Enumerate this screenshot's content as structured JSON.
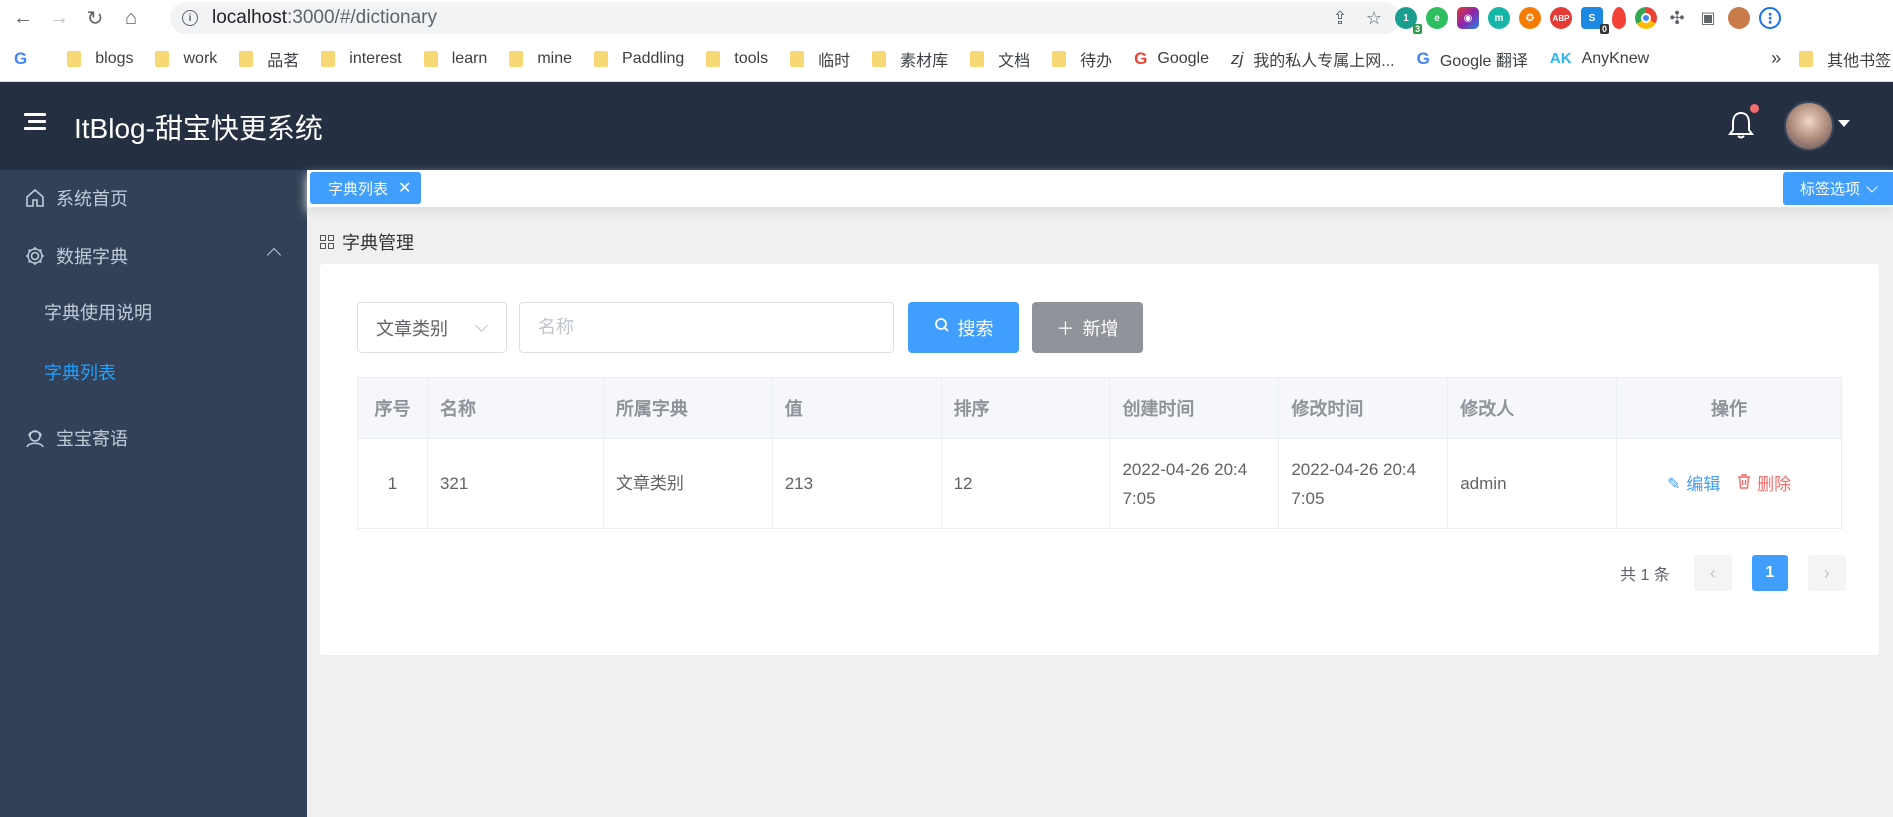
{
  "browser": {
    "url_host": "localhost",
    "url_rest": ":3000/#/dictionary",
    "bookmarks": [
      {
        "label": "blogs",
        "type": "folder"
      },
      {
        "label": "work",
        "type": "folder"
      },
      {
        "label": "品茗",
        "type": "folder"
      },
      {
        "label": "interest",
        "type": "folder"
      },
      {
        "label": "learn",
        "type": "folder"
      },
      {
        "label": "mine",
        "type": "folder"
      },
      {
        "label": "Paddling",
        "type": "folder"
      },
      {
        "label": "tools",
        "type": "folder"
      },
      {
        "label": "临时",
        "type": "folder"
      },
      {
        "label": "素材库",
        "type": "folder"
      },
      {
        "label": "文档",
        "type": "folder"
      },
      {
        "label": "待办",
        "type": "folder"
      },
      {
        "label": "Google",
        "type": "google"
      },
      {
        "label": "我的私人专属上网...",
        "type": "site"
      },
      {
        "label": "Google 翻译",
        "type": "translate"
      },
      {
        "label": "AnyKnew",
        "type": "ak"
      }
    ],
    "bookmark_overflow": "»",
    "other_bookmarks": "其他书签",
    "extension_badges": {
      "first": "3",
      "second": "0"
    }
  },
  "header": {
    "title": "ItBlog-甜宝快更系统"
  },
  "sidebar": {
    "home": "系统首页",
    "dictionary_group": "数据字典",
    "sub_usage": "字典使用说明",
    "sub_list": "字典列表",
    "messages": "宝宝寄语"
  },
  "tags": {
    "active_tag": "字典列表",
    "options": "标签选项"
  },
  "content": {
    "breadcrumb": "字典管理",
    "category_select": "文章类别",
    "name_placeholder": "名称",
    "search_label": "搜索",
    "add_label": "新增"
  },
  "table": {
    "headers": [
      "序号",
      "名称",
      "所属字典",
      "值",
      "排序",
      "创建时间",
      "修改时间",
      "修改人",
      "操作"
    ],
    "rows": [
      {
        "index": "1",
        "name": "321",
        "dictionary": "文章类别",
        "value": "213",
        "sort": "12",
        "created": "2022-04-26 20:4\n7:05",
        "created_a": "2022-04-26 20:4",
        "created_b": "7:05",
        "modified_a": "2022-04-26 20:4",
        "modified_b": "7:05",
        "modifier": "admin",
        "edit_label": "编辑",
        "delete_label": "删除"
      }
    ]
  },
  "pagination": {
    "total": "共 1 条",
    "current": "1"
  },
  "colors": {
    "primary": "#409eff",
    "danger": "#f56c6c",
    "header_bg": "#242f42",
    "sidebar_bg": "#324157"
  }
}
